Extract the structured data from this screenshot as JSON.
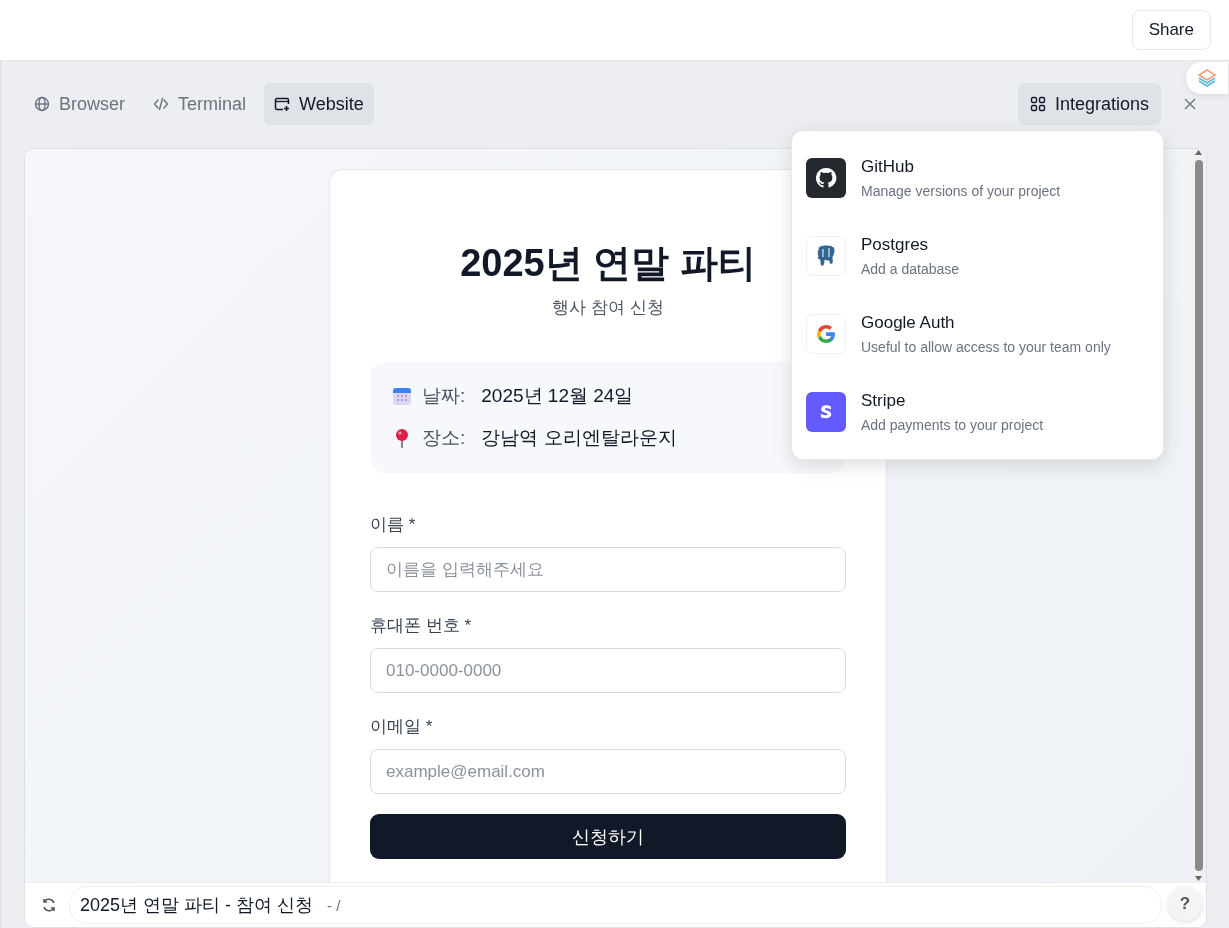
{
  "share_button": "Share",
  "tabs": [
    {
      "kind": "globe",
      "label": "Browser",
      "selected": false
    },
    {
      "kind": "code",
      "label": "Terminal",
      "selected": false
    },
    {
      "kind": "window",
      "label": "Website",
      "selected": true
    }
  ],
  "integrations_button": "Integrations",
  "integrations_menu": [
    {
      "kind": "github",
      "name": "GitHub",
      "description": "Manage versions of your project"
    },
    {
      "kind": "postgres",
      "name": "Postgres",
      "description": "Add a database"
    },
    {
      "kind": "google",
      "name": "Google Auth",
      "description": "Useful to allow access to your team only"
    },
    {
      "kind": "stripe",
      "name": "Stripe",
      "description": "Add payments to your project"
    }
  ],
  "form": {
    "title": "2025년 연말 파티",
    "subtitle": "행사 참여 신청",
    "details": [
      {
        "kind": "date",
        "label": "날짜:",
        "value": "2025년 12월 24일"
      },
      {
        "kind": "place",
        "label": "장소:",
        "value": "강남역 오리엔탈라운지"
      }
    ],
    "fields": [
      {
        "label": "이름 *",
        "placeholder": "이름을 입력해주세요"
      },
      {
        "label": "휴대폰 번호 *",
        "placeholder": "010-0000-0000"
      },
      {
        "label": "이메일 *",
        "placeholder": "example@email.com"
      }
    ],
    "submit": "신청하기"
  },
  "address_bar": {
    "title": "2025년 연말 파티 - 참여 신청",
    "path": "- /"
  },
  "help_button": "?"
}
